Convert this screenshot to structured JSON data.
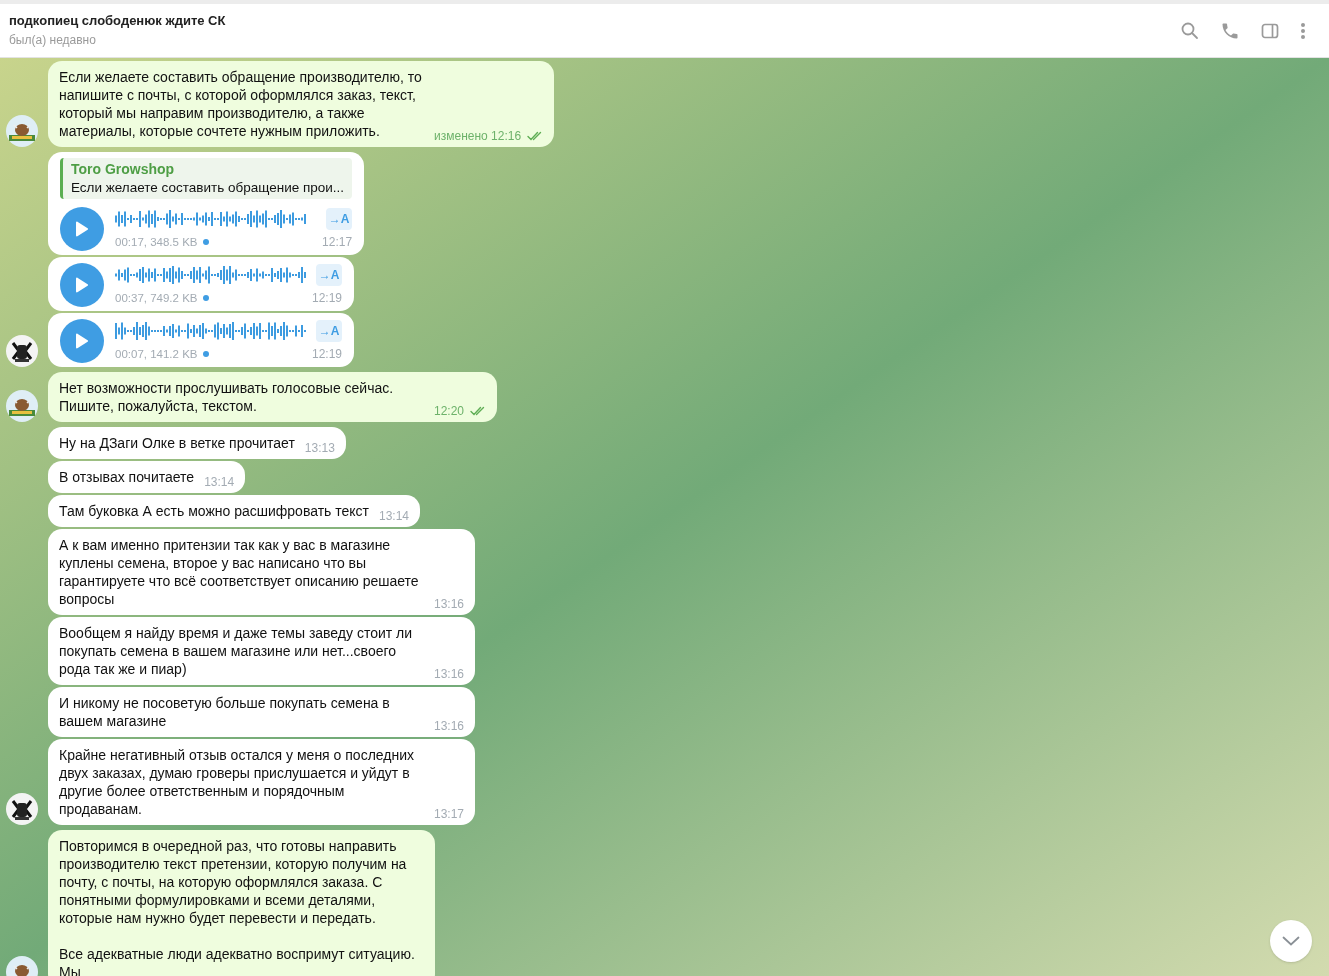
{
  "header": {
    "title": "подкопиец слободенюк ждите СК",
    "status": "был(а) недавно"
  },
  "groups": [
    {
      "kind": "shop",
      "messages": [
        {
          "kind": "text",
          "text": "Если желаете составить обращение производителю, то напишите с почты, с которой оформлялся заказ, текст, который мы направим производителю, а также материалы, которые сочтете нужным приложить.",
          "edited": "изменено",
          "time": "12:16",
          "read": true
        }
      ]
    },
    {
      "kind": "user",
      "messages": [
        {
          "kind": "voice",
          "reply": {
            "name": "Toro Growshop",
            "text": "Если желаете составить обращение прои..."
          },
          "info": "00:17, 348.5 KB",
          "unlistened": true,
          "transcribe": "→A",
          "time": "12:17"
        },
        {
          "kind": "voice",
          "info": "00:37, 749.2 KB",
          "unlistened": true,
          "transcribe": "→A",
          "time": "12:19"
        },
        {
          "kind": "voice",
          "info": "00:07, 141.2 KB",
          "unlistened": true,
          "transcribe": "→A",
          "time": "12:19"
        }
      ]
    },
    {
      "kind": "shop",
      "messages": [
        {
          "kind": "text",
          "text": "Нет возможности прослушивать голосовые сейчас. Пишите, пожалуйста, текстом.",
          "time": "12:20",
          "read": true
        }
      ]
    },
    {
      "kind": "user",
      "messages": [
        {
          "kind": "text",
          "text": "Ну на ДЗаги Олке в ветке прочитает",
          "time": "13:13"
        },
        {
          "kind": "text",
          "text": "В отзывах почитаете",
          "time": "13:14"
        },
        {
          "kind": "text",
          "text": "Там буковка А есть можно расшифровать текст",
          "time": "13:14"
        },
        {
          "kind": "text",
          "text": "А к вам именно притензии так как у вас в магазине куплены семена, второе у вас написано что вы гарантируете что всё соответствует описанию решаете вопросы",
          "time": "13:16"
        },
        {
          "kind": "text",
          "text": "Вообщем я найду время и даже темы заведу стоит ли покупать семена в вашем магазине или нет...своего рода так же и пиар)",
          "time": "13:16"
        },
        {
          "kind": "text",
          "text": "И никому не посоветую больше покупать семена в вашем магазине",
          "time": "13:16"
        },
        {
          "kind": "text",
          "text": "Крайне негативный отзыв остался у меня о последних двух заказах, думаю гроверы прислушается и уйдут в другие более ответственным и порядочным продаванам.",
          "time": "13:17"
        }
      ]
    },
    {
      "kind": "shop",
      "messages": [
        {
          "kind": "text",
          "text": "Повторимся в очередной раз, что готовы направить производителю текст претензии, которую получим на почту, с почты, на которую оформлялся заказа. С понятными формулировками и всеми деталями, которые нам нужно будет перевести и передать.\n\nВсе адекватные люди адекватно воспримут ситуацию. Мы"
        }
      ]
    }
  ]
}
